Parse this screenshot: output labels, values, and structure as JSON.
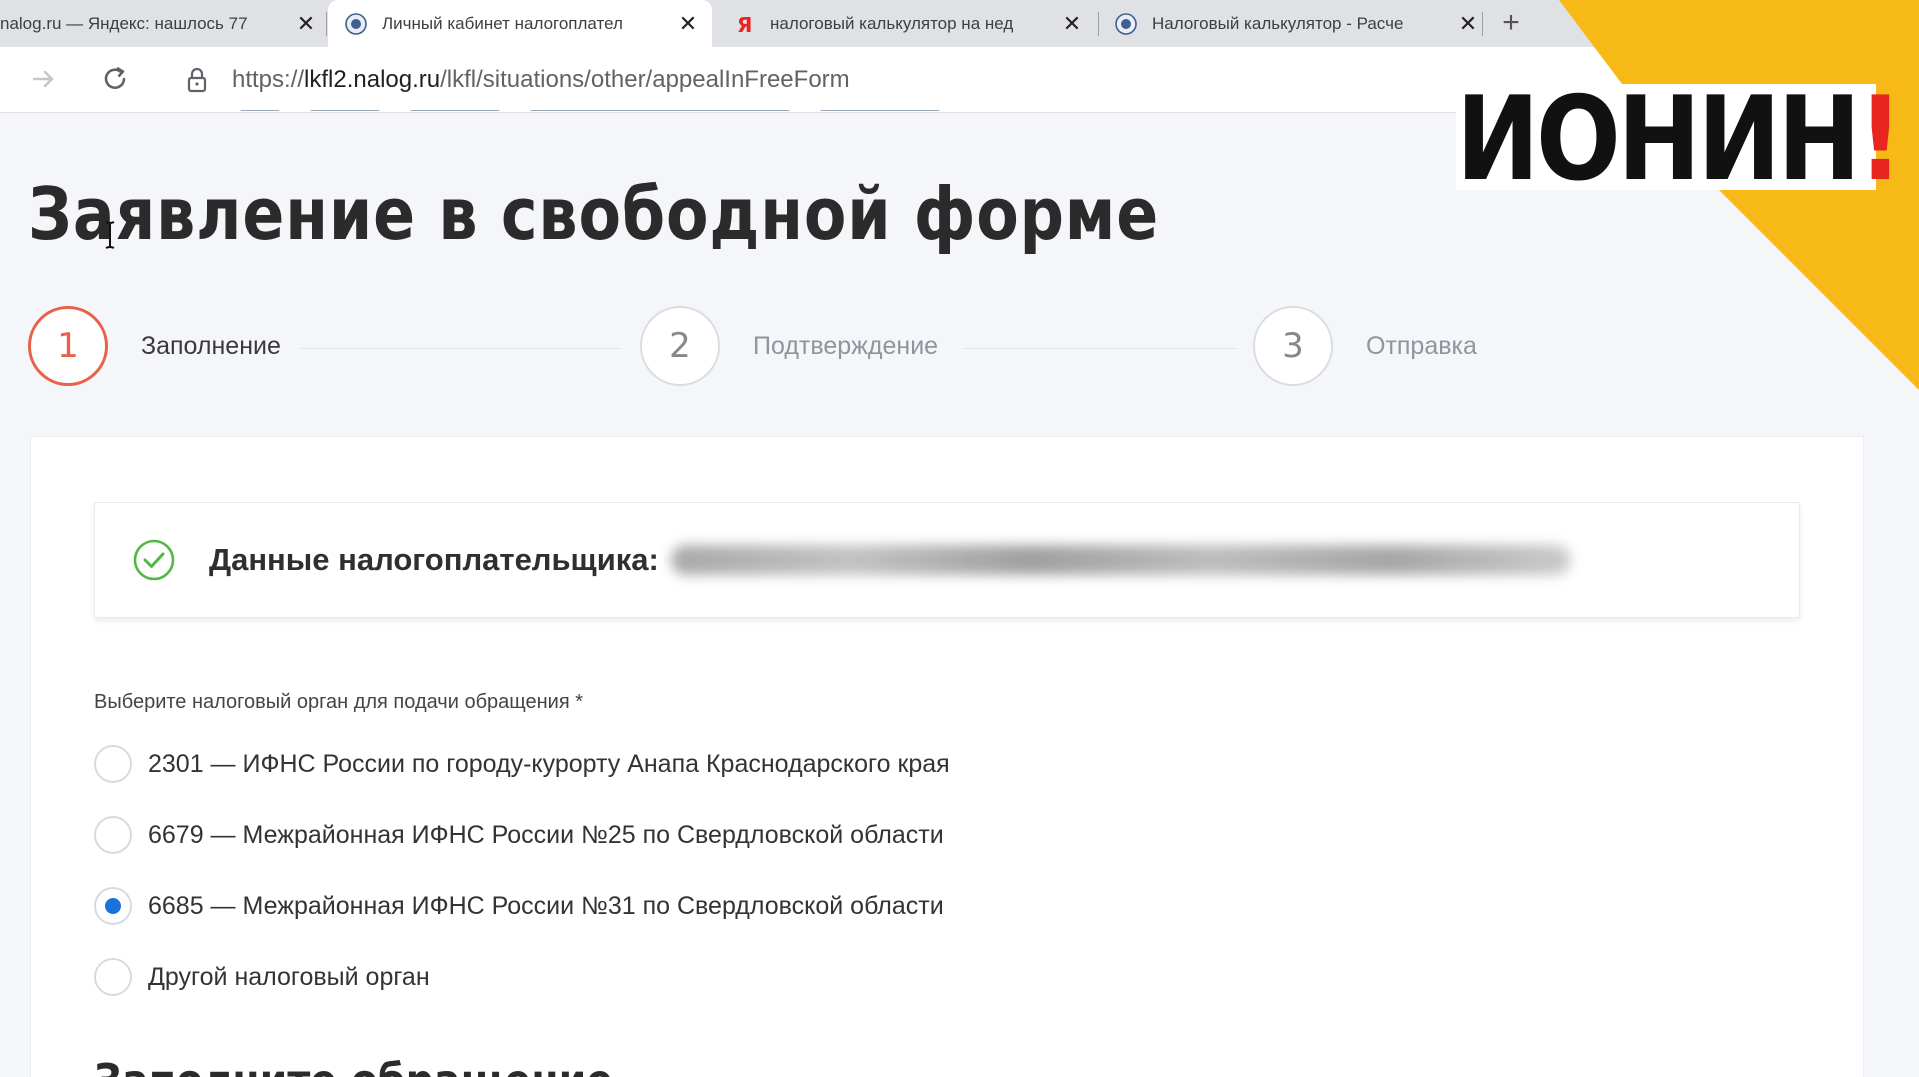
{
  "browser": {
    "tabs": [
      {
        "title": "nalog.ru — Яндекс: нашлось 77",
        "active": false,
        "favicon": "none"
      },
      {
        "title": "Личный кабинет налогоплател",
        "active": true,
        "favicon": "fns-emblem-icon"
      },
      {
        "title": "налоговый калькулятор на нед",
        "active": false,
        "favicon": "yandex-icon"
      },
      {
        "title": "Налоговый калькулятор - Расче",
        "active": false,
        "favicon": "fns-emblem-icon"
      }
    ],
    "url": {
      "scheme": "https://",
      "host": "lkfl2.nalog.ru",
      "path": "/lkfl/situations/other/appealInFreeForm"
    }
  },
  "page": {
    "title": "Заявление в свободной форме",
    "steps": [
      {
        "number": "1",
        "label": "Заполнение",
        "active": true
      },
      {
        "number": "2",
        "label": "Подтверждение",
        "active": false
      },
      {
        "number": "3",
        "label": "Отправка",
        "active": false
      }
    ],
    "taxpayer": {
      "label": "Данные налогоплательщика:"
    },
    "tax_office": {
      "label": "Выберите налоговый орган для подачи обращения *",
      "options": [
        {
          "text": "2301 — ИФНС России по городу-курорту Анапа Краснодарского края",
          "selected": false
        },
        {
          "text": "6679 — Межрайонная ИФНС России №25 по Свердловской области",
          "selected": false
        },
        {
          "text": "6685 — Межрайонная ИФНС России №31 по Свердловской области",
          "selected": true
        },
        {
          "text": "Другой налоговый орган",
          "selected": false
        }
      ]
    },
    "section_heading": "Заполните обращение"
  },
  "overlay": {
    "logo_text": "ИОНИН",
    "logo_mark": "!"
  },
  "colors": {
    "accent_step": "#e8614a",
    "radio_selected": "#1a73d8",
    "check_green": "#52b845",
    "overlay_yellow": "#f7b916",
    "logo_red": "#e8261f"
  }
}
